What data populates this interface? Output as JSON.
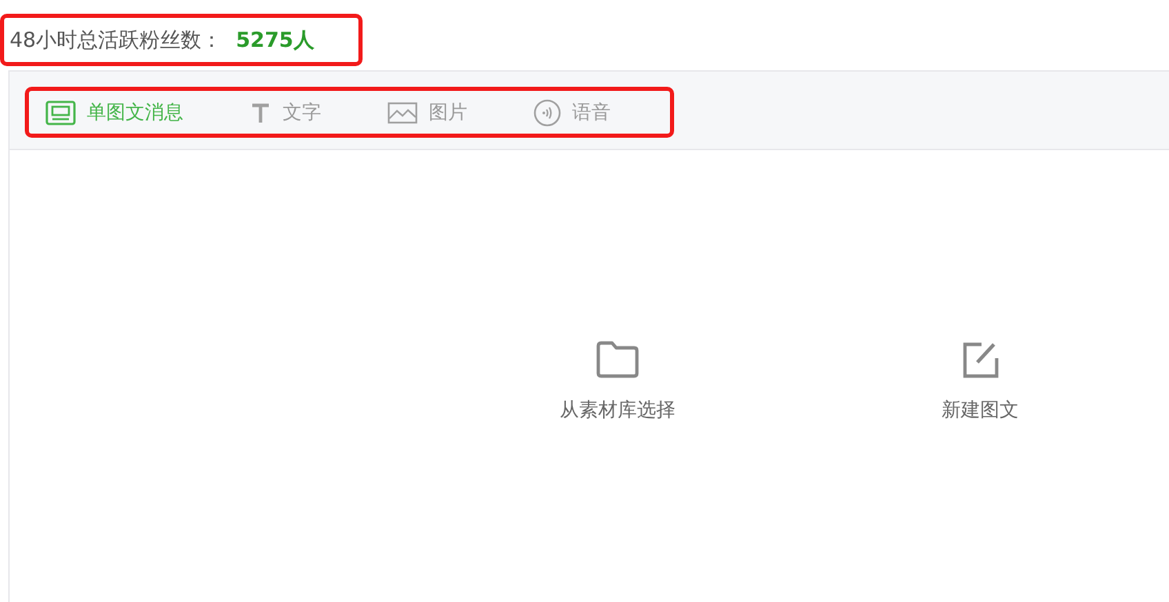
{
  "summary": {
    "label": "48小时总活跃粉丝数：",
    "value": "5275人"
  },
  "tabs": [
    {
      "label": "单图文消息",
      "kind": "news",
      "selected": true
    },
    {
      "label": "文字",
      "kind": "text",
      "selected": false
    },
    {
      "label": "图片",
      "kind": "image",
      "selected": false
    },
    {
      "label": "语音",
      "kind": "voice",
      "selected": false
    }
  ],
  "actions": [
    {
      "label": "从素材库选择",
      "kind": "folder"
    },
    {
      "label": "新建图文",
      "kind": "edit"
    }
  ]
}
